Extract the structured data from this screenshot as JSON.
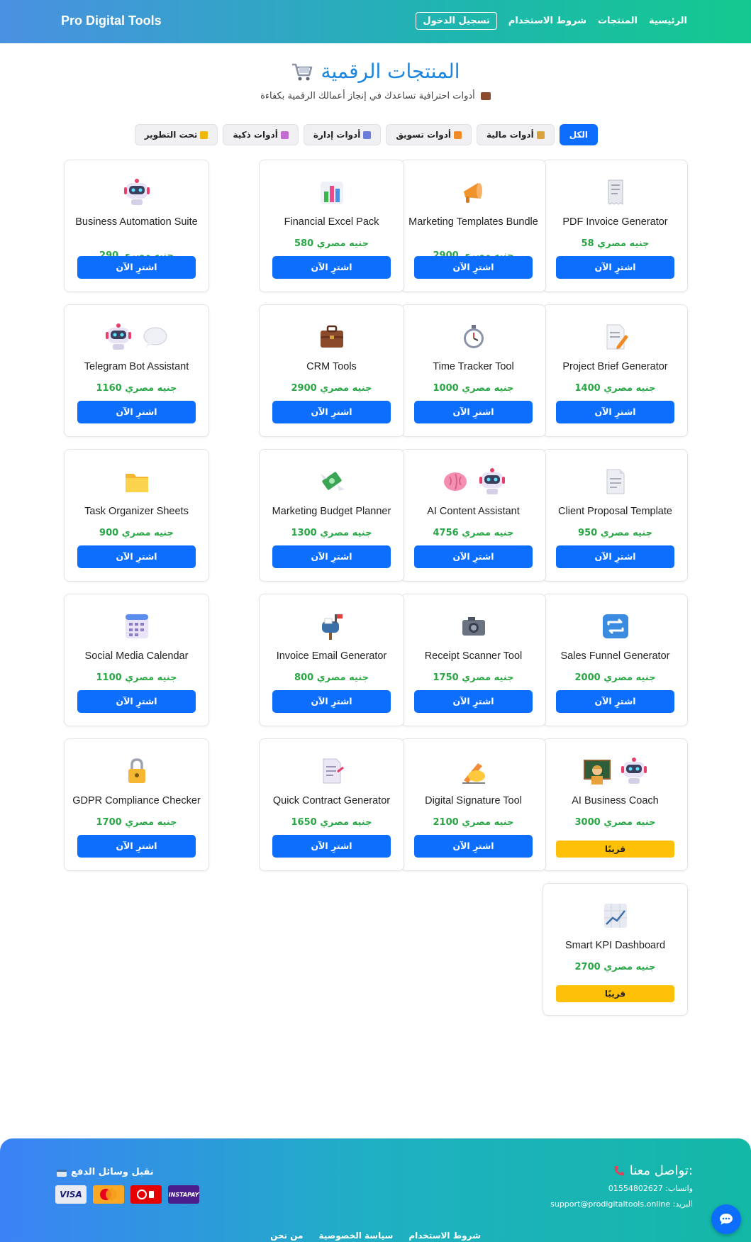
{
  "header": {
    "brand": "Pro Digital Tools",
    "nav": [
      "الرئيسية",
      "المنتجات",
      "شروط الاستخدام"
    ],
    "login": "تسجيل الدخول"
  },
  "page": {
    "title": "المنتجات الرقمية",
    "subtitle": "أدوات احترافية تساعدك في إنجاز أعمالك الرقمية بكفاءة"
  },
  "filters": [
    {
      "label": "الكل",
      "active": true,
      "icon": ""
    },
    {
      "label": "أدوات مالية",
      "active": false,
      "icon": "money-bag-icon"
    },
    {
      "label": "أدوات تسويق",
      "active": false,
      "icon": "megaphone-icon"
    },
    {
      "label": "أدوات إدارة",
      "active": false,
      "icon": "manager-icon"
    },
    {
      "label": "أدوات ذكية",
      "active": false,
      "icon": "robot-icon"
    },
    {
      "label": "تحت التطوير",
      "active": false,
      "icon": "construction-icon"
    }
  ],
  "buy_label": "اشترِ الآن",
  "soon_label": "قريبًا",
  "currency": "جنيه مصري",
  "products": [
    {
      "name": "PDF Invoice Generator",
      "price": "58",
      "icons": [
        "receipt-icon"
      ],
      "status": "buy"
    },
    {
      "name": "Marketing Templates Bundle",
      "price": "2900",
      "icons": [
        "megaphone-icon"
      ],
      "status": "buy"
    },
    {
      "name": "Financial Excel Pack",
      "price": "580",
      "icons": [
        "bar-chart-icon"
      ],
      "status": "buy"
    },
    {
      "name": "Business Automation Suite",
      "price": "290",
      "icons": [
        "robot-icon"
      ],
      "status": "buy"
    },
    {
      "name": "Project Brief Generator",
      "price": "1400",
      "icons": [
        "memo-icon"
      ],
      "status": "buy"
    },
    {
      "name": "Time Tracker Tool",
      "price": "1000",
      "icons": [
        "stopwatch-icon"
      ],
      "status": "buy"
    },
    {
      "name": "CRM Tools",
      "price": "2900",
      "icons": [
        "briefcase-icon"
      ],
      "status": "buy"
    },
    {
      "name": "Telegram Bot Assistant",
      "price": "1160",
      "icons": [
        "robot-icon",
        "speech-bubble-icon"
      ],
      "status": "buy"
    },
    {
      "name": "Client Proposal Template",
      "price": "950",
      "icons": [
        "document-icon"
      ],
      "status": "buy"
    },
    {
      "name": "AI Content Assistant",
      "price": "4756",
      "icons": [
        "brain-icon",
        "robot-icon"
      ],
      "status": "buy"
    },
    {
      "name": "Marketing Budget Planner",
      "price": "1300",
      "icons": [
        "money-wings-icon"
      ],
      "status": "buy"
    },
    {
      "name": "Task Organizer Sheets",
      "price": "900",
      "icons": [
        "folder-icon"
      ],
      "status": "buy"
    },
    {
      "name": "Sales Funnel Generator",
      "price": "2000",
      "icons": [
        "repeat-icon"
      ],
      "status": "buy"
    },
    {
      "name": "Receipt Scanner Tool",
      "price": "1750",
      "icons": [
        "camera-icon"
      ],
      "status": "buy"
    },
    {
      "name": "Invoice Email Generator",
      "price": "800",
      "icons": [
        "mailbox-icon"
      ],
      "status": "buy"
    },
    {
      "name": "Social Media Calendar",
      "price": "1100",
      "icons": [
        "calendar-icon"
      ],
      "status": "buy"
    },
    {
      "name": "AI Business Coach",
      "price": "3000",
      "icons": [
        "teacher-icon",
        "robot-icon"
      ],
      "status": "soon"
    },
    {
      "name": "Digital Signature Tool",
      "price": "2100",
      "icons": [
        "writing-hand-icon"
      ],
      "status": "buy"
    },
    {
      "name": "Quick Contract Generator",
      "price": "1650",
      "icons": [
        "contract-icon"
      ],
      "status": "buy"
    },
    {
      "name": "GDPR Compliance Checker",
      "price": "1700",
      "icons": [
        "lock-icon"
      ],
      "status": "buy"
    },
    {
      "name": "Smart KPI Dashboard",
      "price": "2700",
      "icons": [
        "chart-up-icon"
      ],
      "status": "soon"
    }
  ],
  "footer": {
    "contact_title": ":تواصل معنا",
    "whatsapp_label": "واتساب:",
    "whatsapp": "01554802627",
    "email_label": "البريد:",
    "email": "support@prodigitaltools.online",
    "payment_title": "نقبل وسائل الدفع",
    "payments": [
      "VISA",
      "MasterCard",
      "Vodafone",
      "INSTAPAY"
    ],
    "links": [
      "شروط الاستخدام",
      "سياسة الخصوصية",
      "من نحن"
    ]
  },
  "colors": {
    "primary": "#0d6efd",
    "price": "#29a745",
    "soon": "#ffc107",
    "title": "#1a86e0"
  }
}
